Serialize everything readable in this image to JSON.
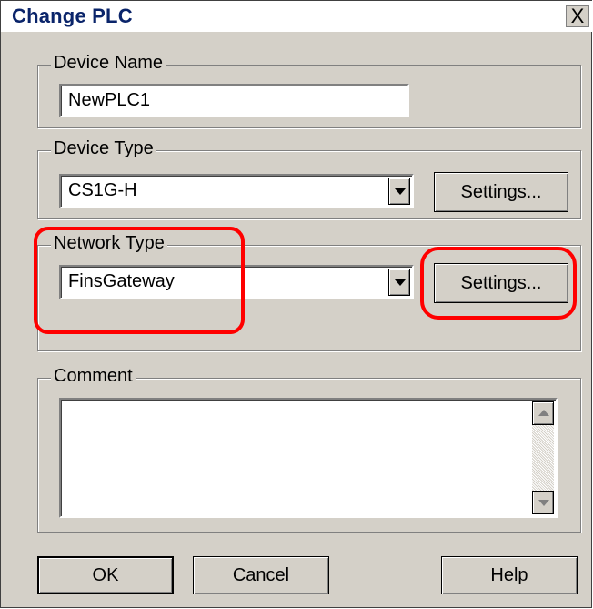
{
  "window": {
    "title": "Change PLC",
    "close_glyph": "X"
  },
  "device_name": {
    "legend": "Device Name",
    "value": "NewPLC1"
  },
  "device_type": {
    "legend": "Device Type",
    "value": "CS1G-H",
    "settings_label": "Settings..."
  },
  "network_type": {
    "legend": "Network Type",
    "value": "FinsGateway",
    "settings_label": "Settings..."
  },
  "comment": {
    "legend": "Comment",
    "value": ""
  },
  "buttons": {
    "ok": "OK",
    "cancel": "Cancel",
    "help": "Help"
  },
  "colors": {
    "dialog_bg": "#d4d0c8",
    "title_text": "#0a246a",
    "annotation": "#ff0000"
  },
  "icons": {
    "dropdown": "chevron-down-icon",
    "scroll_up": "arrow-up-icon",
    "scroll_down": "arrow-down-icon"
  }
}
